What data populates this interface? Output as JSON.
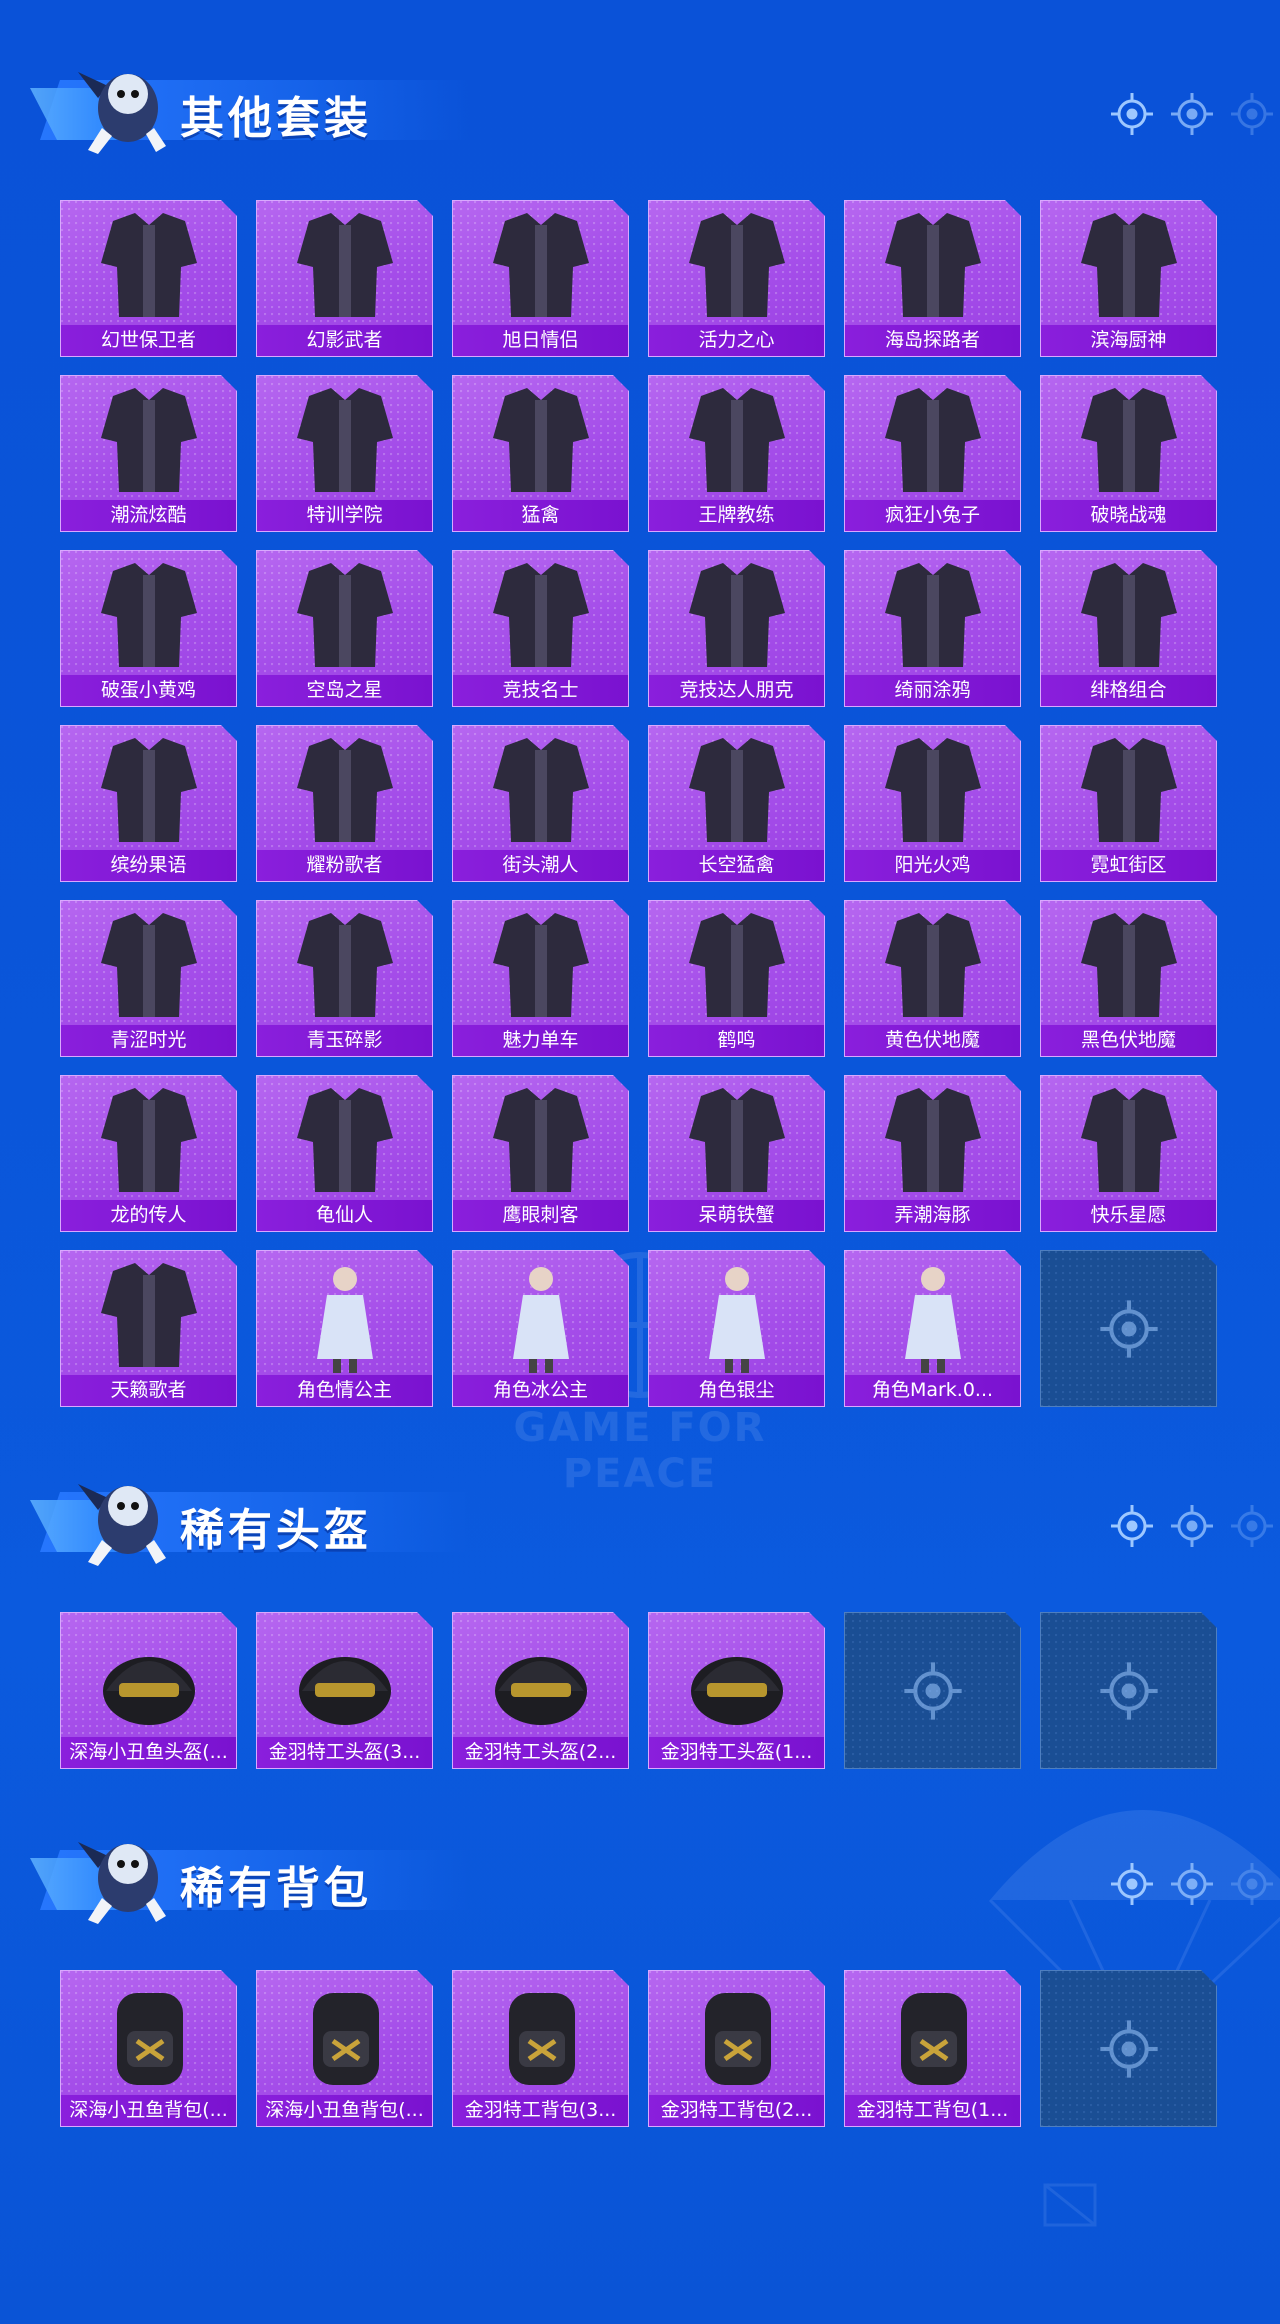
{
  "sections": [
    {
      "title": "其他套装",
      "items": [
        {
          "label": "幻世保卫者",
          "icon": "outfit-icon"
        },
        {
          "label": "幻影武者",
          "icon": "outfit-icon"
        },
        {
          "label": "旭日情侣",
          "icon": "outfit-icon"
        },
        {
          "label": "活力之心",
          "icon": "outfit-icon"
        },
        {
          "label": "海岛探路者",
          "icon": "outfit-icon"
        },
        {
          "label": "滨海厨神",
          "icon": "outfit-icon"
        },
        {
          "label": "潮流炫酷",
          "icon": "outfit-icon"
        },
        {
          "label": "特训学院",
          "icon": "outfit-icon"
        },
        {
          "label": "猛禽",
          "icon": "outfit-icon"
        },
        {
          "label": "王牌教练",
          "icon": "outfit-icon"
        },
        {
          "label": "疯狂小兔子",
          "icon": "outfit-icon"
        },
        {
          "label": "破晓战魂",
          "icon": "outfit-icon"
        },
        {
          "label": "破蛋小黄鸡",
          "icon": "outfit-icon"
        },
        {
          "label": "空岛之星",
          "icon": "outfit-icon"
        },
        {
          "label": "竞技名士",
          "icon": "outfit-icon"
        },
        {
          "label": "竞技达人朋克",
          "icon": "outfit-icon"
        },
        {
          "label": "绮丽涂鸦",
          "icon": "outfit-icon"
        },
        {
          "label": "绯格组合",
          "icon": "outfit-icon"
        },
        {
          "label": "缤纷果语",
          "icon": "outfit-icon"
        },
        {
          "label": "耀粉歌者",
          "icon": "outfit-icon"
        },
        {
          "label": "街头潮人",
          "icon": "outfit-icon"
        },
        {
          "label": "长空猛禽",
          "icon": "outfit-icon"
        },
        {
          "label": "阳光火鸡",
          "icon": "outfit-icon"
        },
        {
          "label": "霓虹街区",
          "icon": "outfit-icon"
        },
        {
          "label": "青涩时光",
          "icon": "outfit-icon"
        },
        {
          "label": "青玉碎影",
          "icon": "outfit-icon"
        },
        {
          "label": "魅力单车",
          "icon": "outfit-icon"
        },
        {
          "label": "鹤鸣",
          "icon": "outfit-icon"
        },
        {
          "label": "黄色伏地魔",
          "icon": "outfit-icon"
        },
        {
          "label": "黑色伏地魔",
          "icon": "outfit-icon"
        },
        {
          "label": "龙的传人",
          "icon": "outfit-icon"
        },
        {
          "label": "龟仙人",
          "icon": "outfit-icon"
        },
        {
          "label": "鹰眼刺客",
          "icon": "outfit-icon"
        },
        {
          "label": "呆萌铁蟹",
          "icon": "outfit-icon"
        },
        {
          "label": "弄潮海豚",
          "icon": "outfit-icon"
        },
        {
          "label": "快乐星愿",
          "icon": "outfit-icon"
        },
        {
          "label": "天籁歌者",
          "icon": "outfit-icon"
        },
        {
          "label": "角色情公主",
          "icon": "character-icon"
        },
        {
          "label": "角色冰公主",
          "icon": "character-icon"
        },
        {
          "label": "角色银尘",
          "icon": "character-icon"
        },
        {
          "label": "角色Mark.0...",
          "icon": "character-icon"
        },
        {
          "empty": true
        }
      ]
    },
    {
      "title": "稀有头盔",
      "items": [
        {
          "label": "深海小丑鱼头盔(...",
          "icon": "helmet-icon"
        },
        {
          "label": "金羽特工头盔(3...",
          "icon": "helmet-icon"
        },
        {
          "label": "金羽特工头盔(2...",
          "icon": "helmet-icon"
        },
        {
          "label": "金羽特工头盔(1...",
          "icon": "helmet-icon"
        },
        {
          "empty": true
        },
        {
          "empty": true
        }
      ]
    },
    {
      "title": "稀有背包",
      "items": [
        {
          "label": "深海小丑鱼背包(...",
          "icon": "backpack-icon"
        },
        {
          "label": "深海小丑鱼背包(...",
          "icon": "backpack-icon"
        },
        {
          "label": "金羽特工背包(3...",
          "icon": "backpack-icon"
        },
        {
          "label": "金羽特工背包(2...",
          "icon": "backpack-icon"
        },
        {
          "label": "金羽特工背包(1...",
          "icon": "backpack-icon"
        },
        {
          "empty": true
        }
      ]
    }
  ],
  "watermark": "GAME FOR PEACE",
  "colors": {
    "background": "#0a55d9",
    "card": "#a44de9",
    "card_label": "#8a1fdc",
    "empty_card": "#1a4e94"
  }
}
